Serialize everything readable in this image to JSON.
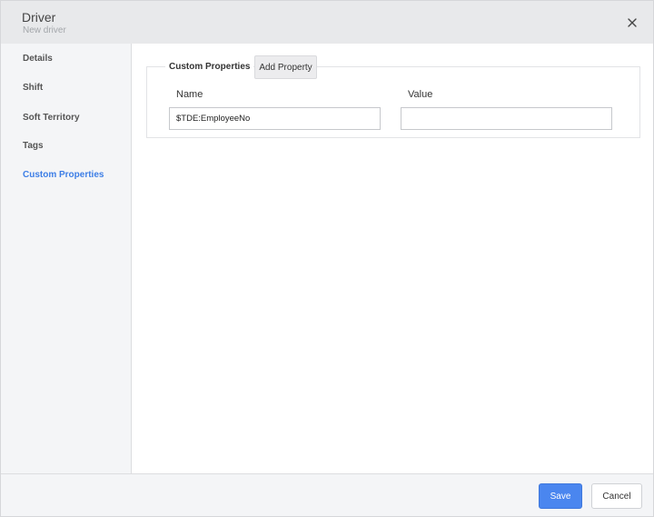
{
  "header": {
    "title": "Driver",
    "subtitle": "New driver",
    "close_icon": "close-icon"
  },
  "sidebar": {
    "items": [
      {
        "label": "Details",
        "active": false
      },
      {
        "label": "Shift",
        "active": false
      },
      {
        "label": "Soft Territory",
        "active": false
      },
      {
        "label": "Tags",
        "active": false
      },
      {
        "label": "Custom Properties",
        "active": true
      }
    ]
  },
  "custom_properties": {
    "legend": "Custom Properties",
    "add_button_label": "Add Property",
    "columns": {
      "name": "Name",
      "value": "Value"
    },
    "rows": [
      {
        "name": "$TDE:EmployeeNo",
        "value": ""
      }
    ]
  },
  "footer": {
    "save_label": "Save",
    "cancel_label": "Cancel"
  },
  "colors": {
    "accent": "#4a86ef",
    "active_nav": "#3d7ee6",
    "header_bg": "#e8e9eb",
    "sidebar_bg": "#f4f5f7"
  }
}
